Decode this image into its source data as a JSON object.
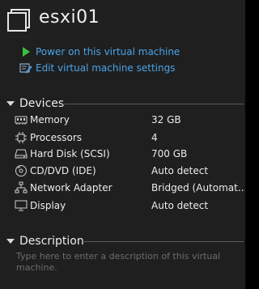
{
  "vm": {
    "name": "esxi01"
  },
  "actions": [
    {
      "label": "Power on this virtual machine",
      "icon": "play-icon"
    },
    {
      "label": "Edit virtual machine settings",
      "icon": "edit-settings-icon"
    }
  ],
  "devices": {
    "heading": "Devices",
    "items": [
      {
        "name": "Memory",
        "value": "32 GB",
        "icon": "memory-icon"
      },
      {
        "name": "Processors",
        "value": "4",
        "icon": "processor-icon"
      },
      {
        "name": "Hard Disk (SCSI)",
        "value": "700 GB",
        "icon": "hard-disk-icon"
      },
      {
        "name": "CD/DVD (IDE)",
        "value": "Auto detect",
        "icon": "cd-dvd-icon"
      },
      {
        "name": "Network Adapter",
        "value": "Bridged (Automat...",
        "icon": "network-adapter-icon"
      },
      {
        "name": "Display",
        "value": "Auto detect",
        "icon": "display-icon"
      }
    ]
  },
  "description": {
    "heading": "Description",
    "placeholder": "Type here to enter a description of this virtual machine."
  },
  "colors": {
    "link": "#4aa3e8",
    "background": "#1f1f1f",
    "placeholder": "#6d6d6d"
  }
}
